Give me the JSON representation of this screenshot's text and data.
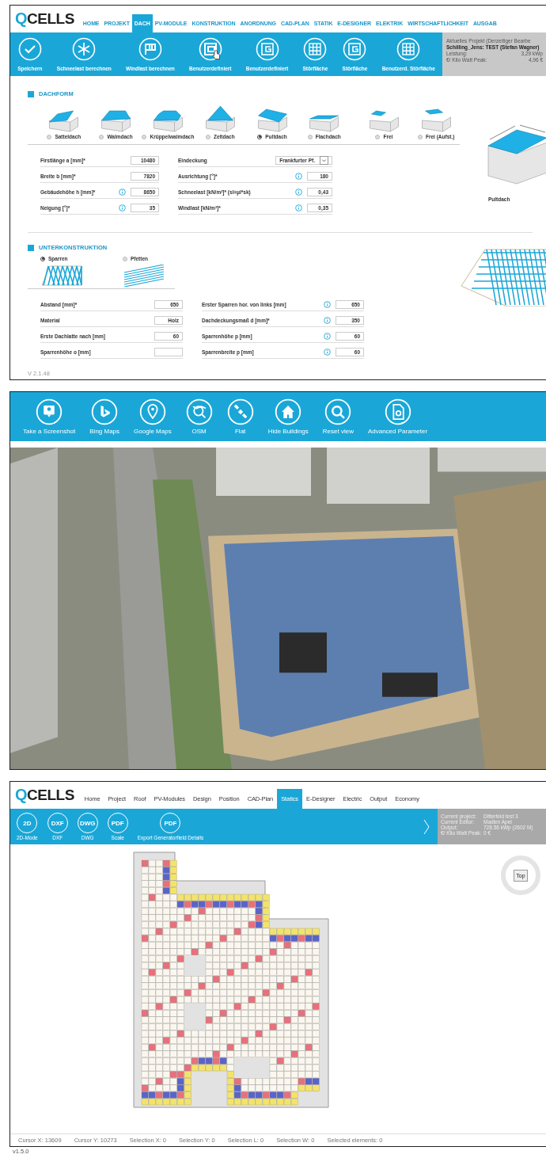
{
  "dach_screen": {
    "logo": {
      "mark": "Q",
      "text": "CELLS"
    },
    "nav": [
      {
        "label": "HOME",
        "selected": false
      },
      {
        "label": "PROJEKT",
        "selected": false
      },
      {
        "label": "DACH",
        "selected": true
      },
      {
        "label": "PV-MODULE",
        "selected": false
      },
      {
        "label": "KONSTRUKTION",
        "selected": false
      },
      {
        "label": "ANORDNUNG",
        "selected": false
      },
      {
        "label": "CAD-PLAN",
        "selected": false
      },
      {
        "label": "STATIK",
        "selected": false
      },
      {
        "label": "E-DESIGNER",
        "selected": false
      },
      {
        "label": "ELEKTRIK",
        "selected": false
      },
      {
        "label": "WIRTSCHAFTLICHKEIT",
        "selected": false
      },
      {
        "label": "AUSGAB",
        "selected": false
      }
    ],
    "toolbar": [
      {
        "label": "Speichern",
        "hovered": false
      },
      {
        "label": "Schneelast berechnen",
        "hovered": false
      },
      {
        "label": "Windlast berechnen",
        "hovered": false
      },
      {
        "label": "Benutzerdefiniert",
        "hovered": true
      },
      {
        "label": "Benutzerdefiniert",
        "hovered": false
      },
      {
        "label": "Störfläche",
        "hovered": false
      },
      {
        "label": "Störfläche",
        "hovered": false
      },
      {
        "label": "Benutzerd. Störfläche",
        "hovered": false
      }
    ],
    "project_info": {
      "title": "Aktuelles Projekt (Derzeitiger Bearbe",
      "name": "Schilling_Jens: TEST (Stefan Wagner)",
      "rows": [
        {
          "label": "Leistung:",
          "value": "3,29 kWp"
        },
        {
          "label": "€/ Kilo Watt Peak:",
          "value": "4,96 €"
        }
      ]
    },
    "dachform": {
      "title": "DACHFORM",
      "roof_types": [
        {
          "label": "Satteldach",
          "selected": false
        },
        {
          "label": "Walmdach",
          "selected": false
        },
        {
          "label": "Krüppelwalmdach",
          "selected": false
        },
        {
          "label": "Zeltdach",
          "selected": false
        },
        {
          "label": "Pultdach",
          "selected": true
        },
        {
          "label": "Flachdach",
          "selected": false
        },
        {
          "label": "Frei",
          "selected": false
        },
        {
          "label": "Frei (Aufst.)",
          "selected": false
        }
      ],
      "preview_label": "Pultdach",
      "fields_left": [
        {
          "label": "Firstlänge a [mm]*",
          "value": "10480",
          "info": false,
          "kind": "input"
        },
        {
          "label": "Breite b [mm]*",
          "value": "7820",
          "info": false,
          "kind": "input"
        },
        {
          "label": "Gebäudehöhe h [mm]*",
          "value": "8650",
          "info": true,
          "kind": "input"
        },
        {
          "label": "Neigung [°]*",
          "value": "35",
          "info": true,
          "kind": "input"
        }
      ],
      "fields_right": [
        {
          "label": "Eindeckung",
          "value": "Frankfurter Pf.",
          "info": false,
          "kind": "select"
        },
        {
          "label": "Ausrichtung [°]*",
          "value": "180",
          "info": true,
          "kind": "input"
        },
        {
          "label": "Schneelast  [kN/m²]* (sl=µi*sk)",
          "value": "0,43",
          "info": true,
          "kind": "input"
        },
        {
          "label": "Windlast  [kN/m²]*",
          "value": "0,35",
          "info": true,
          "kind": "input"
        }
      ]
    },
    "unterkonstruktion": {
      "title": "UNTERKONSTRUKTION",
      "options": [
        {
          "label": "Sparren",
          "selected": true
        },
        {
          "label": "Pfetten",
          "selected": false
        }
      ],
      "fields_left": [
        {
          "label": "Abstand [mm]*",
          "value": "650",
          "info": false,
          "kind": "input"
        },
        {
          "label": "Material",
          "value": "Holz",
          "info": false,
          "kind": "input"
        },
        {
          "label": "Erste Dachlatte nach [mm]",
          "value": "60",
          "info": false,
          "kind": "input"
        },
        {
          "label": "Sparrenhöhe o [mm]",
          "info": false,
          "kind": "input"
        }
      ],
      "fields_right": [
        {
          "label": "Erster Sparren hor. von links [mm]",
          "value": "650",
          "info": true,
          "kind": "input"
        },
        {
          "label": "Dachdeckungsmaß d [mm]*",
          "value": "350",
          "info": true,
          "kind": "input"
        },
        {
          "label": "Sparrenhöhe p [mm]",
          "value": "60",
          "info": true,
          "kind": "input"
        },
        {
          "label": "Sparrenbreite p [mm]",
          "value": "60",
          "info": true,
          "kind": "input"
        }
      ]
    },
    "version": "V 2.1.48"
  },
  "map_screen": {
    "toolbar": [
      {
        "label": "Take a Screenshot"
      },
      {
        "label": "Bing Maps"
      },
      {
        "label": "Google Maps"
      },
      {
        "label": "OSM"
      },
      {
        "label": "Flat"
      },
      {
        "label": "Hide Buildings"
      },
      {
        "label": "Reset view"
      },
      {
        "label": "Advanced Parameter"
      }
    ]
  },
  "statics_screen": {
    "logo": {
      "mark": "Q",
      "text": "CELLS"
    },
    "nav": [
      {
        "label": "Home",
        "selected": false
      },
      {
        "label": "Project",
        "selected": false
      },
      {
        "label": "Roof",
        "selected": false
      },
      {
        "label": "PV-Modules",
        "selected": false
      },
      {
        "label": "Design",
        "selected": false
      },
      {
        "label": "Position",
        "selected": false
      },
      {
        "label": "CAD-Plan",
        "selected": false
      },
      {
        "label": "Statics",
        "selected": true
      },
      {
        "label": "E-Designer",
        "selected": false
      },
      {
        "label": "Electric",
        "selected": false
      },
      {
        "label": "Output",
        "selected": false
      },
      {
        "label": "Economy",
        "selected": false
      }
    ],
    "toolbar": [
      {
        "badge": "2D",
        "label": "2D-Mode"
      },
      {
        "badge": "DXF",
        "label": "DXF"
      },
      {
        "badge": "DWG",
        "label": "DWG"
      },
      {
        "badge": "PDF",
        "label": "Scale"
      },
      {
        "badge": "PDF",
        "label": "Export Generatorfield Details"
      }
    ],
    "project_info": [
      {
        "label": "Current project:",
        "value": "Ditterfeld test 3"
      },
      {
        "label": "Current Editor:",
        "value": "Madlen Apel"
      },
      {
        "label": "Output:",
        "value": "728.56 kWp (2602 M)"
      },
      {
        "label": "€/ Kilo Watt Peak:",
        "value": "0 €"
      }
    ],
    "compass_button": "Top",
    "status_bar": [
      "Cursor X: 13609",
      "Cursor Y: 10273",
      "Selection X: 0",
      "Selection Y: 0",
      "Selection L: 0",
      "Selection W: 0",
      "Selected elements: 0"
    ]
  },
  "footer_version": "v1.5.0"
}
